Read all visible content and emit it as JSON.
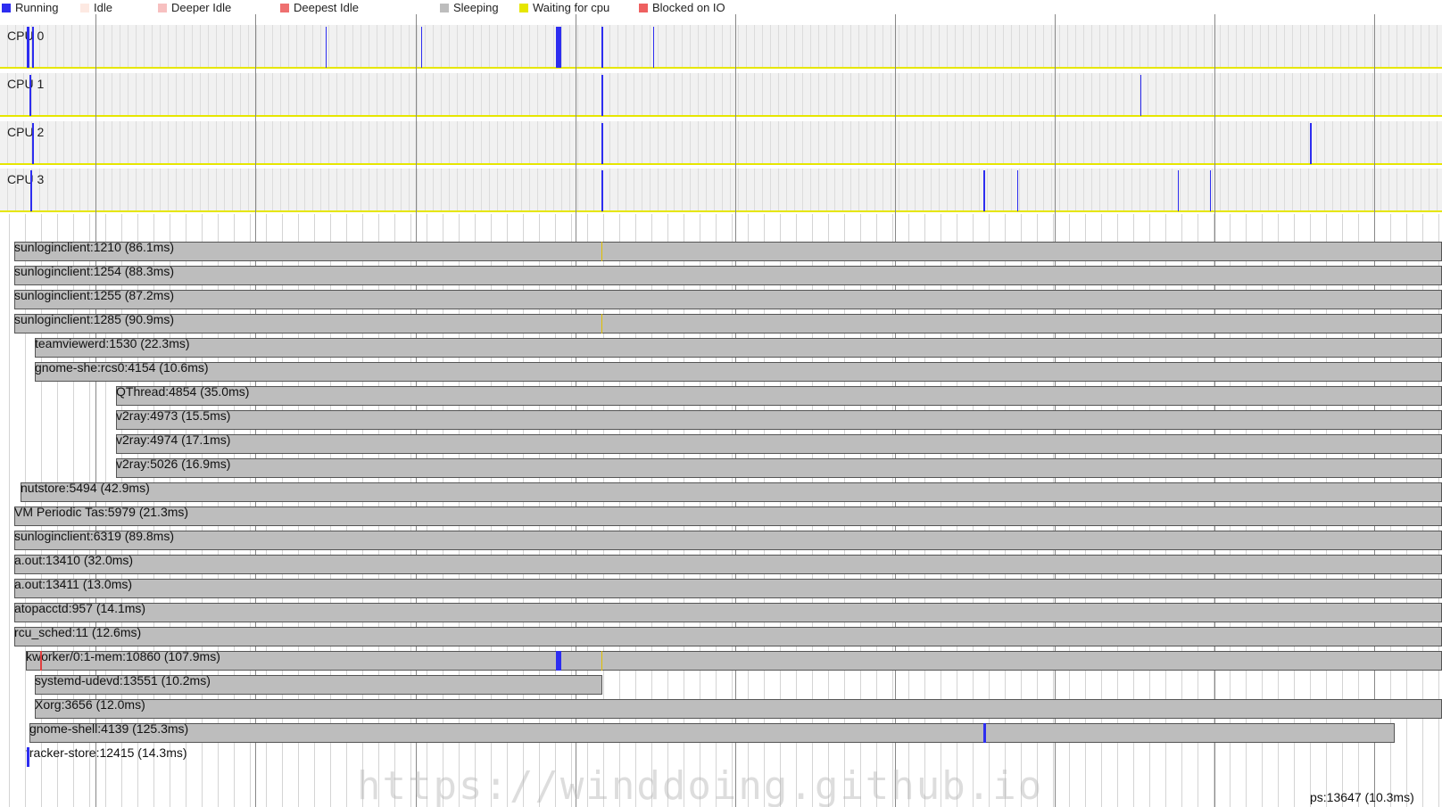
{
  "legend": [
    {
      "label": "Running",
      "color": "#2d2df0"
    },
    {
      "label": "Idle",
      "color": "#fde9e2"
    },
    {
      "label": "Deeper Idle",
      "color": "#f7c0c0"
    },
    {
      "label": "Deepest Idle",
      "color": "#ee7070"
    },
    {
      "label": "Sleeping",
      "color": "#bdbdbd"
    },
    {
      "label": "Waiting for cpu",
      "color": "#e6e600"
    },
    {
      "label": "Blocked on IO",
      "color": "#ee6060"
    }
  ],
  "cpus": [
    "CPU 0",
    "CPU 1",
    "CPU 2",
    "CPU 3"
  ],
  "processes": [
    "sunloginclient:1210 (86.1ms)",
    "sunloginclient:1254 (88.3ms)",
    "sunloginclient:1255 (87.2ms)",
    "sunloginclient:1285 (90.9ms)",
    "teamviewerd:1530 (22.3ms)",
    "gnome-she:rcs0:4154 (10.6ms)",
    "QThread:4854 (35.0ms)",
    "v2ray:4973 (15.5ms)",
    "v2ray:4974 (17.1ms)",
    "v2ray:5026 (16.9ms)",
    "nutstore:5494 (42.9ms)",
    "VM Periodic Tas:5979 (21.3ms)",
    "sunloginclient:6319 (89.8ms)",
    "a.out:13410 (32.0ms)",
    "a.out:13411 (13.0ms)",
    "atopacctd:957 (14.1ms)",
    "rcu_sched:11 (12.6ms)",
    "kworker/0:1-mem:10860 (107.9ms)",
    "systemd-udevd:13551 (10.2ms)",
    "Xorg:3656 (12.0ms)",
    "gnome-shell:4139 (125.3ms)",
    "tracker-store:12415 (14.3ms)"
  ],
  "corner_label": "ps:13647 (10.3ms)",
  "watermark": "https://winddoing.github.io"
}
